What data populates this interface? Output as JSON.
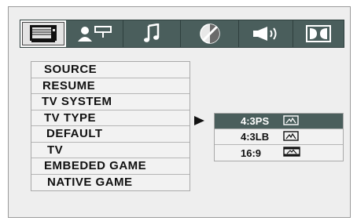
{
  "colors": {
    "tab_bar": "#4a5e5c",
    "selected_row": "#4a5e5c",
    "panel_bg": "#eeeeee"
  },
  "tabs": [
    {
      "name": "tv-screen-icon",
      "active": true
    },
    {
      "name": "person-remote-icon",
      "active": false
    },
    {
      "name": "music-note-icon",
      "active": false
    },
    {
      "name": "color-circle-icon",
      "active": false
    },
    {
      "name": "speaker-icon",
      "active": false
    },
    {
      "name": "dolby-icon",
      "active": false
    }
  ],
  "menu": {
    "items": [
      {
        "label": "SOURCE"
      },
      {
        "label": "RESUME"
      },
      {
        "label": "TV SYSTEM"
      },
      {
        "label": "TV TYPE"
      },
      {
        "label": "DEFAULT"
      },
      {
        "label": "TV"
      },
      {
        "label": "EMBEDED GAME"
      },
      {
        "label": "NATIVE GAME"
      }
    ]
  },
  "submenu": {
    "items": [
      {
        "label": "4:3PS",
        "icon": "ratio-4-3-ps-icon",
        "selected": true
      },
      {
        "label": "4:3LB",
        "icon": "ratio-4-3-lb-icon",
        "selected": false
      },
      {
        "label": "16:9",
        "icon": "ratio-16-9-icon",
        "selected": false
      }
    ]
  }
}
